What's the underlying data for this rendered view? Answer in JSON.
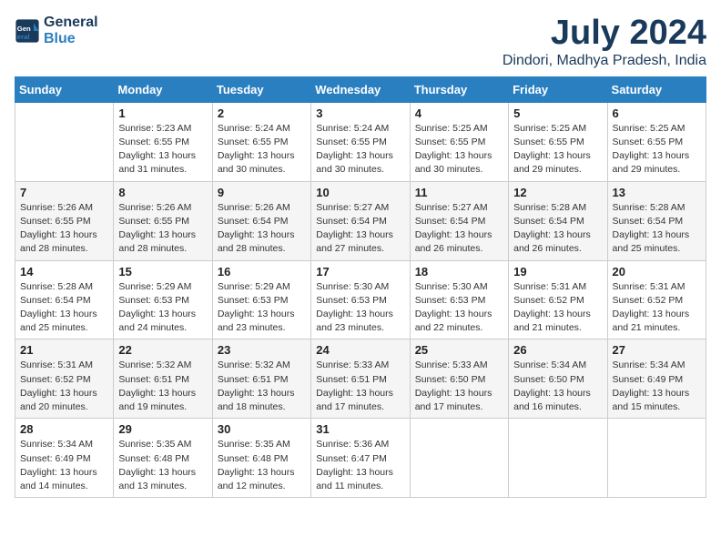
{
  "header": {
    "logo_line1": "General",
    "logo_line2": "Blue",
    "month_title": "July 2024",
    "location": "Dindori, Madhya Pradesh, India"
  },
  "weekdays": [
    "Sunday",
    "Monday",
    "Tuesday",
    "Wednesday",
    "Thursday",
    "Friday",
    "Saturday"
  ],
  "weeks": [
    [
      {
        "day": "",
        "info": ""
      },
      {
        "day": "1",
        "info": "Sunrise: 5:23 AM\nSunset: 6:55 PM\nDaylight: 13 hours\nand 31 minutes."
      },
      {
        "day": "2",
        "info": "Sunrise: 5:24 AM\nSunset: 6:55 PM\nDaylight: 13 hours\nand 30 minutes."
      },
      {
        "day": "3",
        "info": "Sunrise: 5:24 AM\nSunset: 6:55 PM\nDaylight: 13 hours\nand 30 minutes."
      },
      {
        "day": "4",
        "info": "Sunrise: 5:25 AM\nSunset: 6:55 PM\nDaylight: 13 hours\nand 30 minutes."
      },
      {
        "day": "5",
        "info": "Sunrise: 5:25 AM\nSunset: 6:55 PM\nDaylight: 13 hours\nand 29 minutes."
      },
      {
        "day": "6",
        "info": "Sunrise: 5:25 AM\nSunset: 6:55 PM\nDaylight: 13 hours\nand 29 minutes."
      }
    ],
    [
      {
        "day": "7",
        "info": "Sunrise: 5:26 AM\nSunset: 6:55 PM\nDaylight: 13 hours\nand 28 minutes."
      },
      {
        "day": "8",
        "info": "Sunrise: 5:26 AM\nSunset: 6:55 PM\nDaylight: 13 hours\nand 28 minutes."
      },
      {
        "day": "9",
        "info": "Sunrise: 5:26 AM\nSunset: 6:54 PM\nDaylight: 13 hours\nand 28 minutes."
      },
      {
        "day": "10",
        "info": "Sunrise: 5:27 AM\nSunset: 6:54 PM\nDaylight: 13 hours\nand 27 minutes."
      },
      {
        "day": "11",
        "info": "Sunrise: 5:27 AM\nSunset: 6:54 PM\nDaylight: 13 hours\nand 26 minutes."
      },
      {
        "day": "12",
        "info": "Sunrise: 5:28 AM\nSunset: 6:54 PM\nDaylight: 13 hours\nand 26 minutes."
      },
      {
        "day": "13",
        "info": "Sunrise: 5:28 AM\nSunset: 6:54 PM\nDaylight: 13 hours\nand 25 minutes."
      }
    ],
    [
      {
        "day": "14",
        "info": "Sunrise: 5:28 AM\nSunset: 6:54 PM\nDaylight: 13 hours\nand 25 minutes."
      },
      {
        "day": "15",
        "info": "Sunrise: 5:29 AM\nSunset: 6:53 PM\nDaylight: 13 hours\nand 24 minutes."
      },
      {
        "day": "16",
        "info": "Sunrise: 5:29 AM\nSunset: 6:53 PM\nDaylight: 13 hours\nand 23 minutes."
      },
      {
        "day": "17",
        "info": "Sunrise: 5:30 AM\nSunset: 6:53 PM\nDaylight: 13 hours\nand 23 minutes."
      },
      {
        "day": "18",
        "info": "Sunrise: 5:30 AM\nSunset: 6:53 PM\nDaylight: 13 hours\nand 22 minutes."
      },
      {
        "day": "19",
        "info": "Sunrise: 5:31 AM\nSunset: 6:52 PM\nDaylight: 13 hours\nand 21 minutes."
      },
      {
        "day": "20",
        "info": "Sunrise: 5:31 AM\nSunset: 6:52 PM\nDaylight: 13 hours\nand 21 minutes."
      }
    ],
    [
      {
        "day": "21",
        "info": "Sunrise: 5:31 AM\nSunset: 6:52 PM\nDaylight: 13 hours\nand 20 minutes."
      },
      {
        "day": "22",
        "info": "Sunrise: 5:32 AM\nSunset: 6:51 PM\nDaylight: 13 hours\nand 19 minutes."
      },
      {
        "day": "23",
        "info": "Sunrise: 5:32 AM\nSunset: 6:51 PM\nDaylight: 13 hours\nand 18 minutes."
      },
      {
        "day": "24",
        "info": "Sunrise: 5:33 AM\nSunset: 6:51 PM\nDaylight: 13 hours\nand 17 minutes."
      },
      {
        "day": "25",
        "info": "Sunrise: 5:33 AM\nSunset: 6:50 PM\nDaylight: 13 hours\nand 17 minutes."
      },
      {
        "day": "26",
        "info": "Sunrise: 5:34 AM\nSunset: 6:50 PM\nDaylight: 13 hours\nand 16 minutes."
      },
      {
        "day": "27",
        "info": "Sunrise: 5:34 AM\nSunset: 6:49 PM\nDaylight: 13 hours\nand 15 minutes."
      }
    ],
    [
      {
        "day": "28",
        "info": "Sunrise: 5:34 AM\nSunset: 6:49 PM\nDaylight: 13 hours\nand 14 minutes."
      },
      {
        "day": "29",
        "info": "Sunrise: 5:35 AM\nSunset: 6:48 PM\nDaylight: 13 hours\nand 13 minutes."
      },
      {
        "day": "30",
        "info": "Sunrise: 5:35 AM\nSunset: 6:48 PM\nDaylight: 13 hours\nand 12 minutes."
      },
      {
        "day": "31",
        "info": "Sunrise: 5:36 AM\nSunset: 6:47 PM\nDaylight: 13 hours\nand 11 minutes."
      },
      {
        "day": "",
        "info": ""
      },
      {
        "day": "",
        "info": ""
      },
      {
        "day": "",
        "info": ""
      }
    ]
  ]
}
